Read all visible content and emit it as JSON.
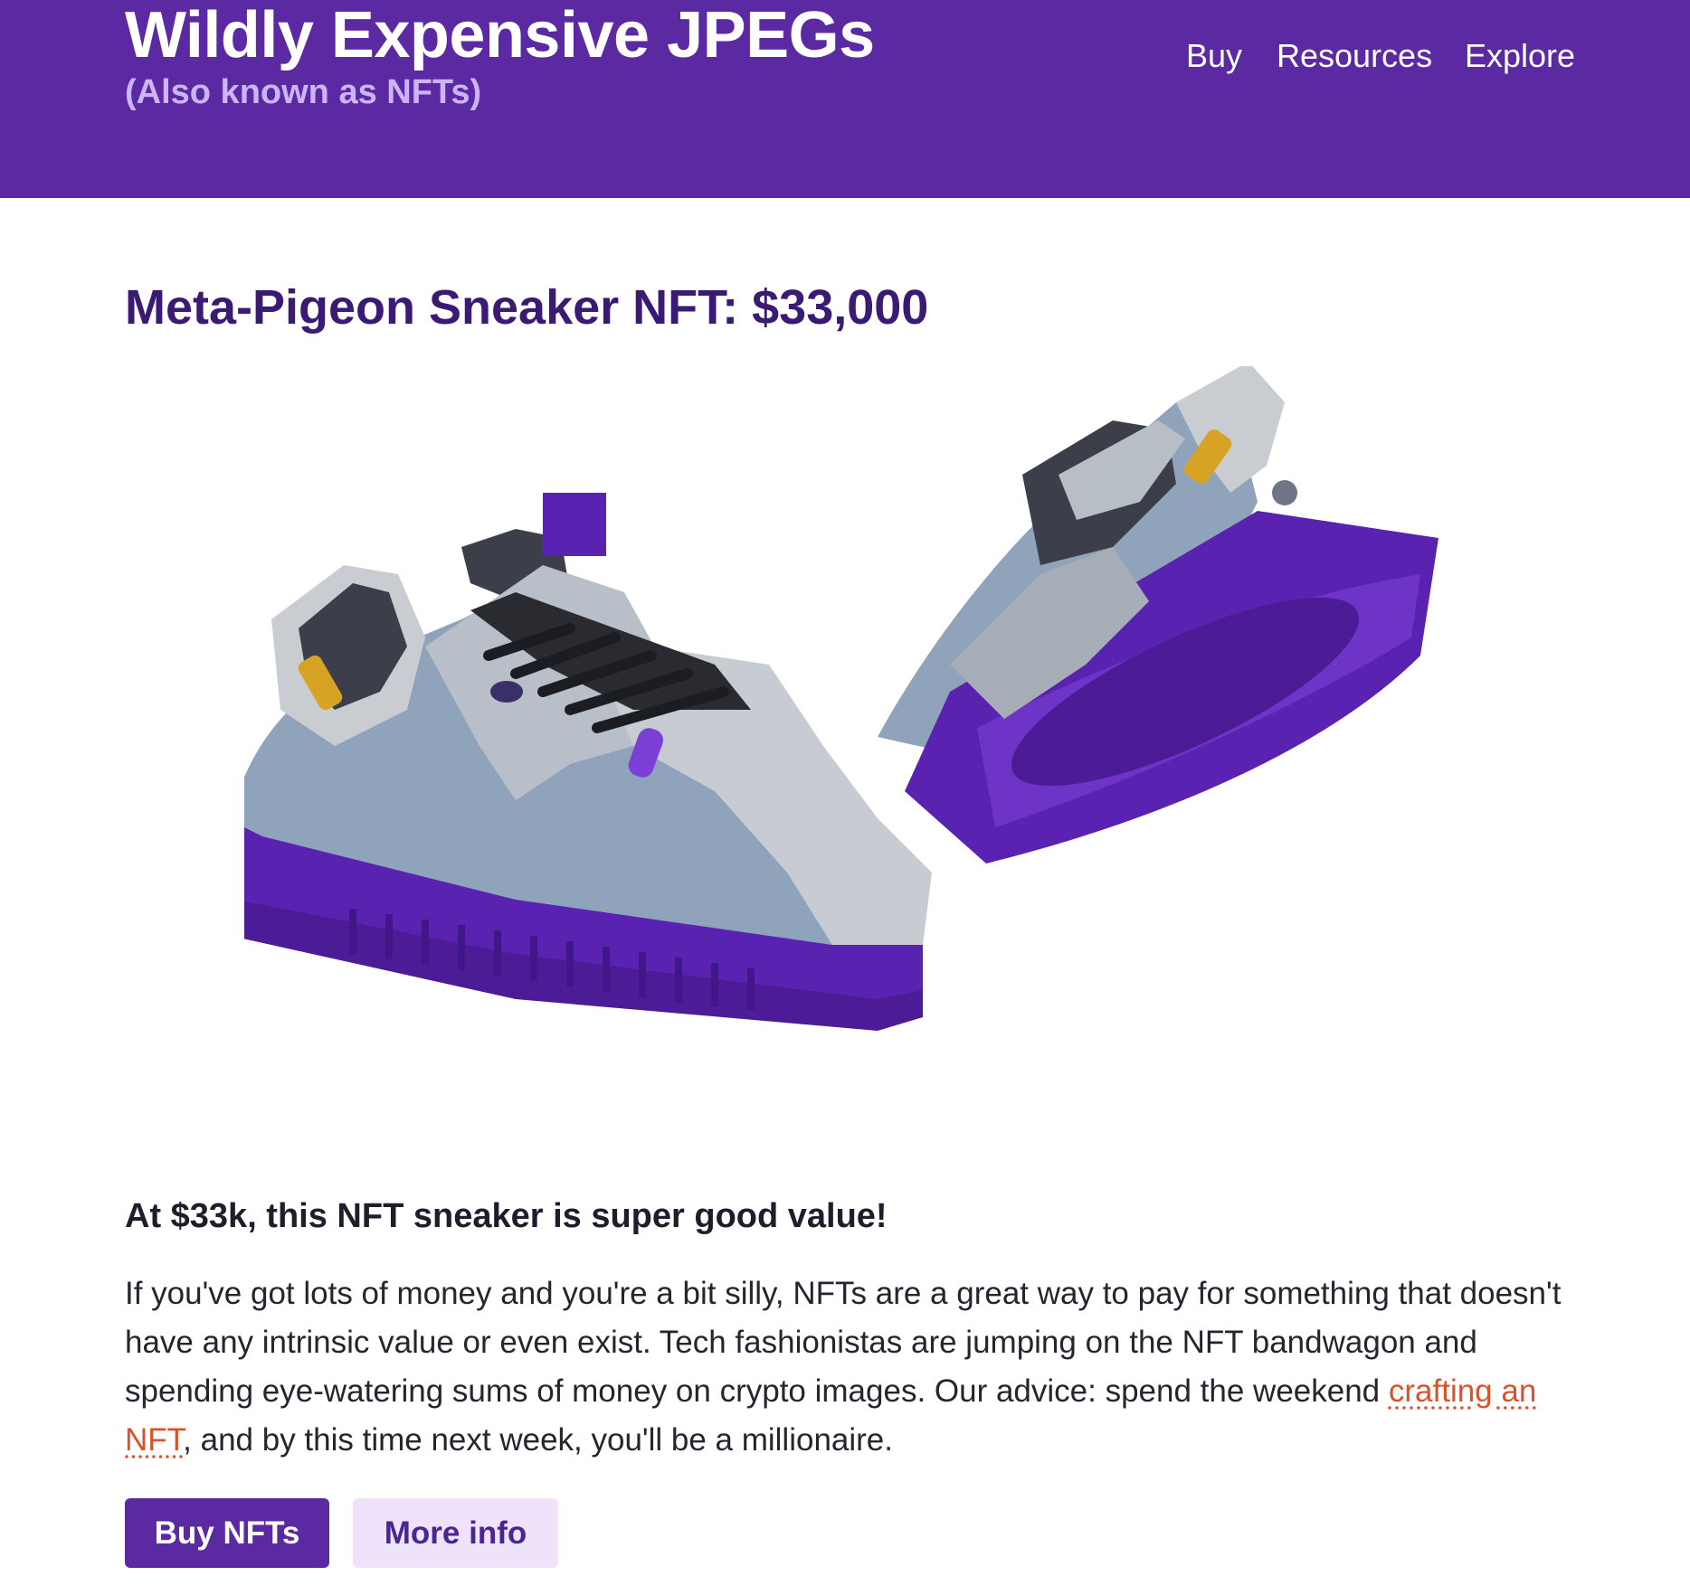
{
  "header": {
    "title": "Wildly Expensive JPEGs",
    "subtitle": "(Also known as NFTs)",
    "nav": [
      {
        "label": "Buy"
      },
      {
        "label": "Resources"
      },
      {
        "label": "Explore"
      }
    ]
  },
  "main": {
    "heading": "Meta-Pigeon Sneaker NFT: $33,000",
    "lead": "At $33k, this NFT sneaker is super good value!",
    "body_before_link": "If you've got lots of money and you're a bit silly, NFTs are a great way to pay for something that doesn't have any intrinsic value or even exist. Tech fashionistas are jumping on the NFT bandwagon and spending eye-watering sums of money on crypto images. Our advice: spend the weekend ",
    "link_text": "crafting an NFT",
    "body_after_link": ", and by this time next week, you'll be a millionaire.",
    "buttons": {
      "primary": "Buy NFTs",
      "secondary": "More info"
    }
  },
  "colors": {
    "header_bg": "#5b2aa3",
    "heading": "#3b1a73",
    "link": "#d9532a",
    "sole": "#5a22b0",
    "secondary_button_bg": "#efe2fb"
  }
}
